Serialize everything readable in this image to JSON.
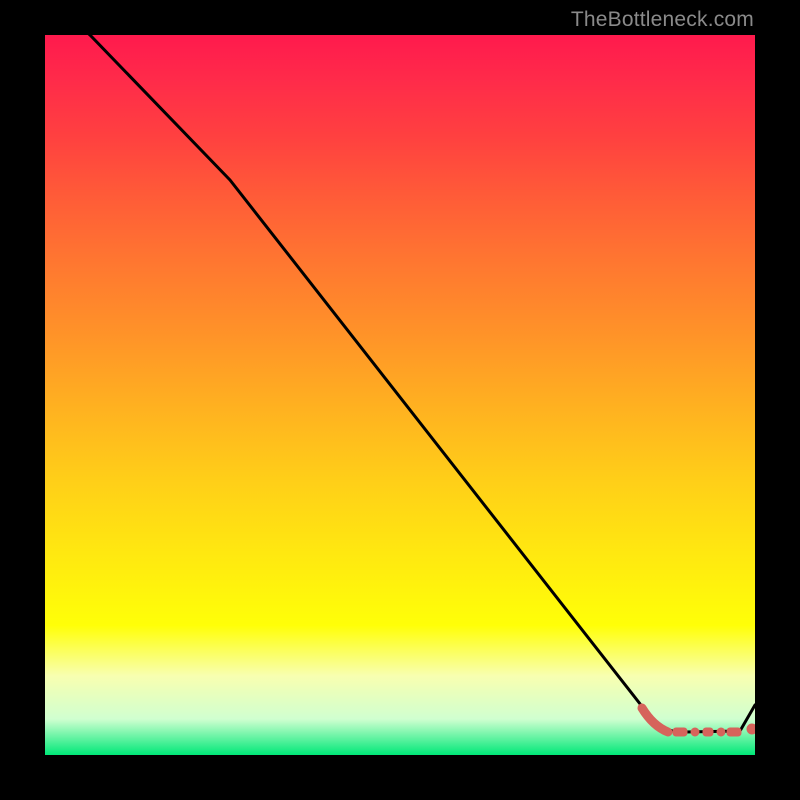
{
  "attribution": "TheBottleneck.com",
  "colors": {
    "background": "#000000",
    "gradient_top": "#ff1a4d",
    "gradient_mid": "#ffff08",
    "gradient_bottom": "#00e878",
    "line": "#000000",
    "marker": "#d6635b"
  },
  "chart_data": {
    "type": "line",
    "title": "",
    "xlabel": "",
    "ylabel": "",
    "xlim": [
      0,
      100
    ],
    "ylim": [
      0,
      100
    ],
    "series": [
      {
        "name": "curve",
        "x": [
          0,
          6,
          26,
          86,
          90,
          98,
          100
        ],
        "y": [
          106,
          100,
          80,
          4.5,
          3.5,
          3.5,
          7
        ]
      }
    ],
    "markers": {
      "style": "thick-dotted",
      "x_range": [
        84,
        97
      ],
      "y": 3.5
    },
    "grid": false,
    "legend": false
  }
}
